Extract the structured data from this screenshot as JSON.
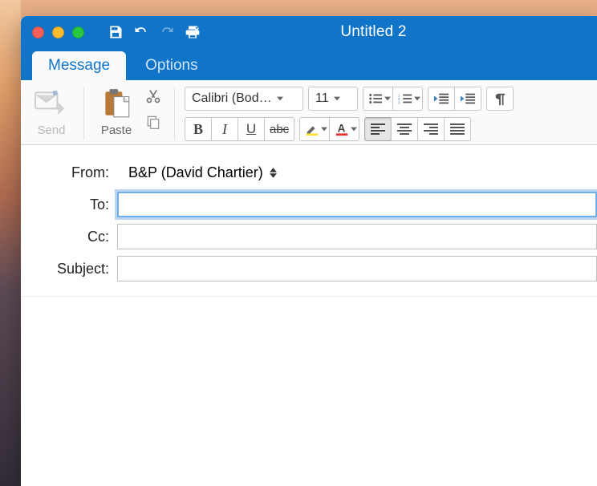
{
  "window": {
    "title": "Untitled 2"
  },
  "tabs": {
    "message": "Message",
    "options": "Options"
  },
  "toolbar": {
    "send_label": "Send",
    "paste_label": "Paste",
    "font_name": "Calibri (Bod…",
    "font_size": "11",
    "strike_text": "abc"
  },
  "fields": {
    "from_label": "From:",
    "from_value": "B&P (David Chartier)",
    "to_label": "To:",
    "to_value": "",
    "cc_label": "Cc:",
    "cc_value": "",
    "subject_label": "Subject:",
    "subject_value": ""
  }
}
